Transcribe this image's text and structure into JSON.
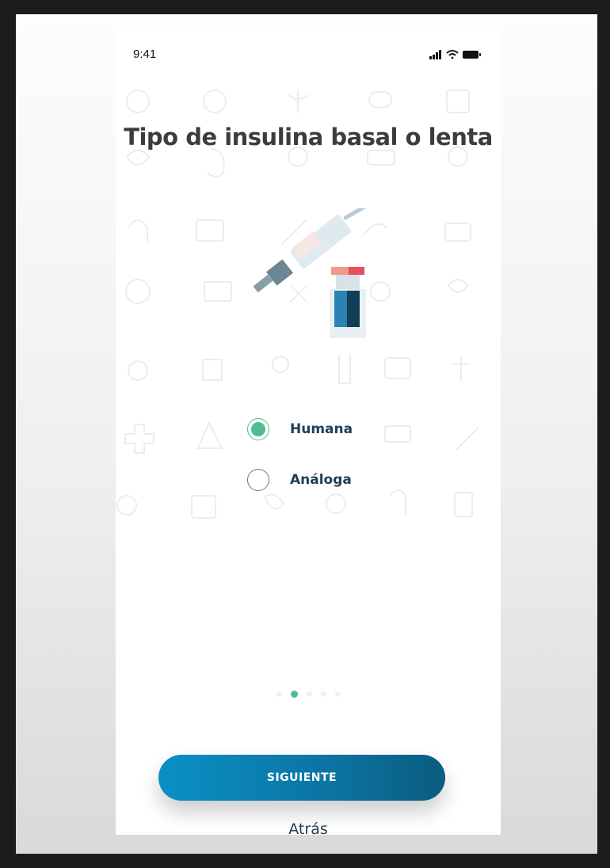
{
  "status_bar": {
    "time": "9:41"
  },
  "title": "Tipo de insulina basal o lenta",
  "options": [
    {
      "label": "Humana",
      "selected": true
    },
    {
      "label": "Análoga",
      "selected": false
    }
  ],
  "pagination": {
    "total": 5,
    "current": 2
  },
  "buttons": {
    "next": "SIGUIENTE",
    "back": "Atrás"
  },
  "colors": {
    "accent": "#4dbd8d",
    "primary": "#0b76a6",
    "title": "#3c3c3c",
    "label": "#1f4057"
  },
  "icons": [
    "signal-icon",
    "wifi-icon",
    "battery-icon",
    "syringe-icon",
    "insulin-vial-icon",
    "medical-pattern"
  ]
}
